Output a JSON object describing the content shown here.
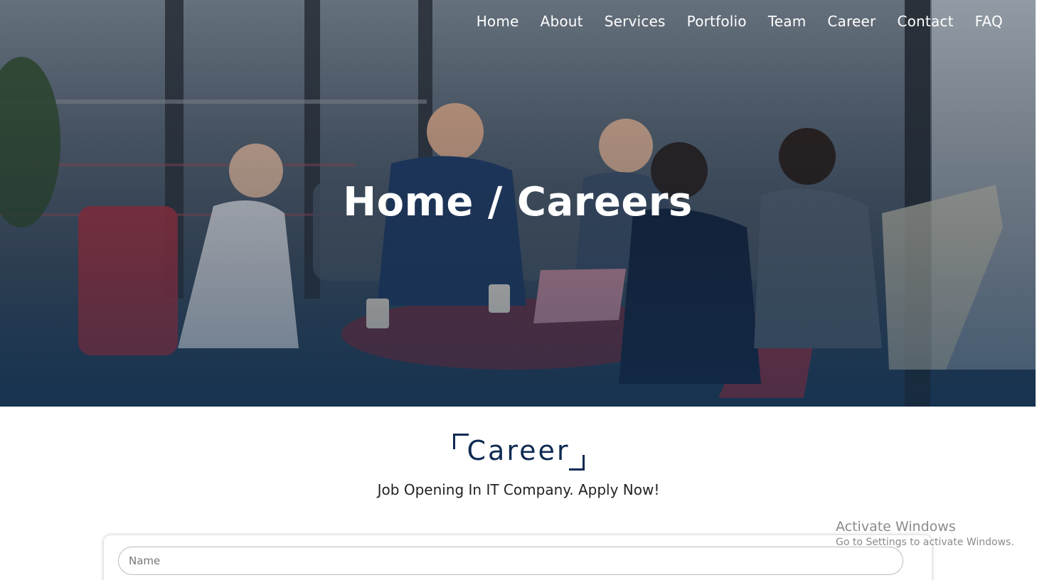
{
  "nav": {
    "items": [
      {
        "label": "Home"
      },
      {
        "label": "About"
      },
      {
        "label": "Services"
      },
      {
        "label": "Portfolio"
      },
      {
        "label": "Team"
      },
      {
        "label": "Career"
      },
      {
        "label": "Contact"
      },
      {
        "label": "FAQ"
      }
    ]
  },
  "hero": {
    "breadcrumb_title": "Home / Careers"
  },
  "career_section": {
    "heading": "Career",
    "subtitle": "Job Opening In IT Company. Apply Now!"
  },
  "form": {
    "name_placeholder": "Name",
    "name_value": ""
  },
  "os_watermark": {
    "line1": "Activate Windows",
    "line2": "Go to Settings to activate Windows."
  },
  "colors": {
    "brand_navy": "#0d2a52",
    "nav_text": "#ffffff"
  }
}
